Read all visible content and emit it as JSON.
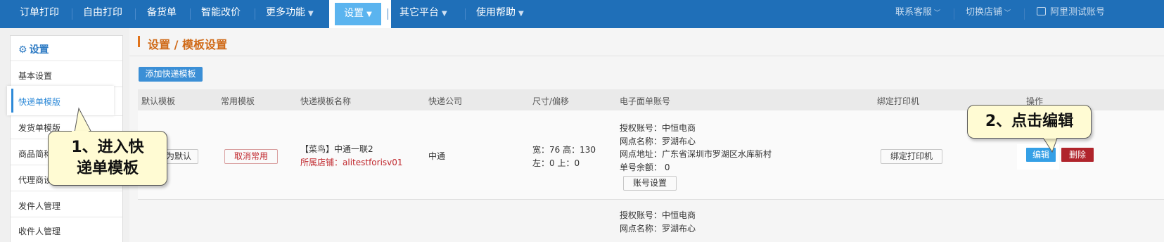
{
  "nav": {
    "items": [
      "订单打印",
      "自由打印",
      "备货单",
      "智能改价",
      "更多功能",
      "设置",
      "其它平台",
      "使用帮助"
    ],
    "right": [
      "联系客服",
      "切换店铺",
      "阿里测试账号"
    ]
  },
  "sidebar": {
    "title": "设置",
    "items": [
      "基本设置",
      "快递单模版",
      "发货单模版",
      "商品简称",
      "代理商设置",
      "发件人管理",
      "收件人管理"
    ]
  },
  "page": {
    "breadcrumb": "设置 / 模板设置",
    "add_button": "添加快递模板"
  },
  "table": {
    "headers": [
      "默认模板",
      "常用模板",
      "快递模板名称",
      "快递公司",
      "尺寸/偏移",
      "电子面单账号",
      "绑定打印机",
      "操作"
    ],
    "row1": {
      "default_btn": "设为默认",
      "common_btn": "取消常用",
      "template_name": "【菜鸟】中通一联2",
      "shop_label": "所属店铺：alitestforisv01",
      "company": "中通",
      "size_line1": "宽：76 高：130",
      "size_line2": "左：0 上：0",
      "account_line1": "授权账号：中恒电商",
      "account_line2": "网点名称：罗湖布心",
      "account_line3": "网点地址：广东省深圳市罗湖区水库新村",
      "account_line4": "单号余额：  0",
      "account_settings_btn": "账号设置",
      "printer_btn": "绑定打印机",
      "edit_btn": "编辑",
      "delete_btn": "删除"
    },
    "row2": {
      "account_line1": "授权账号：中恒电商",
      "account_line2": "网点名称：罗湖布心"
    }
  },
  "callouts": {
    "step1_line1": "1、进入快",
    "step1_line2": "递单模板",
    "step2": "2、点击编辑"
  }
}
